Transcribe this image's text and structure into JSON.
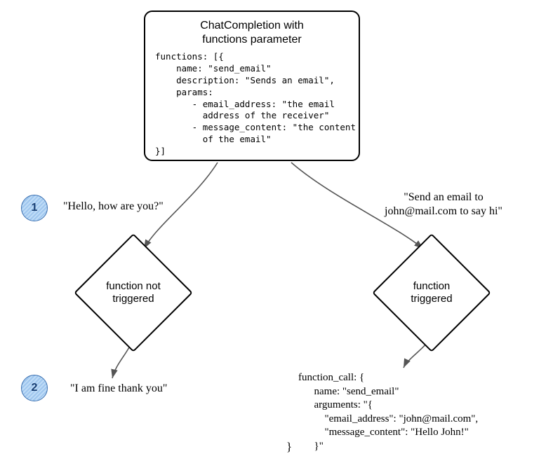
{
  "topbox": {
    "title_line1": "ChatCompletion with",
    "title_line2": "functions parameter",
    "code": "functions: [{\n    name: \"send_email\"\n    description: \"Sends an email\",\n    params:\n       - email_address: \"the email\n         address of the receiver\"\n       - message_content: \"the content\n         of the email\"\n}]"
  },
  "badges": {
    "one": "1",
    "two": "2"
  },
  "left_branch": {
    "query": "\"Hello, how are you?\"",
    "diamond_line1": "function not",
    "diamond_line2": "triggered",
    "answer": "\"I am fine thank you\""
  },
  "right_branch": {
    "query_line1": "\"Send an email to",
    "query_line2": "john@mail.com to say hi\"",
    "diamond_line1": "function",
    "diamond_line2": "triggered",
    "output": "function_call: {\n      name: \"send_email\"\n      arguments: \"{\n          \"email_address\": \"john@mail.com\",\n          \"message_content\": \"Hello John!\"\n      }\""
  },
  "closing_brace": "}"
}
